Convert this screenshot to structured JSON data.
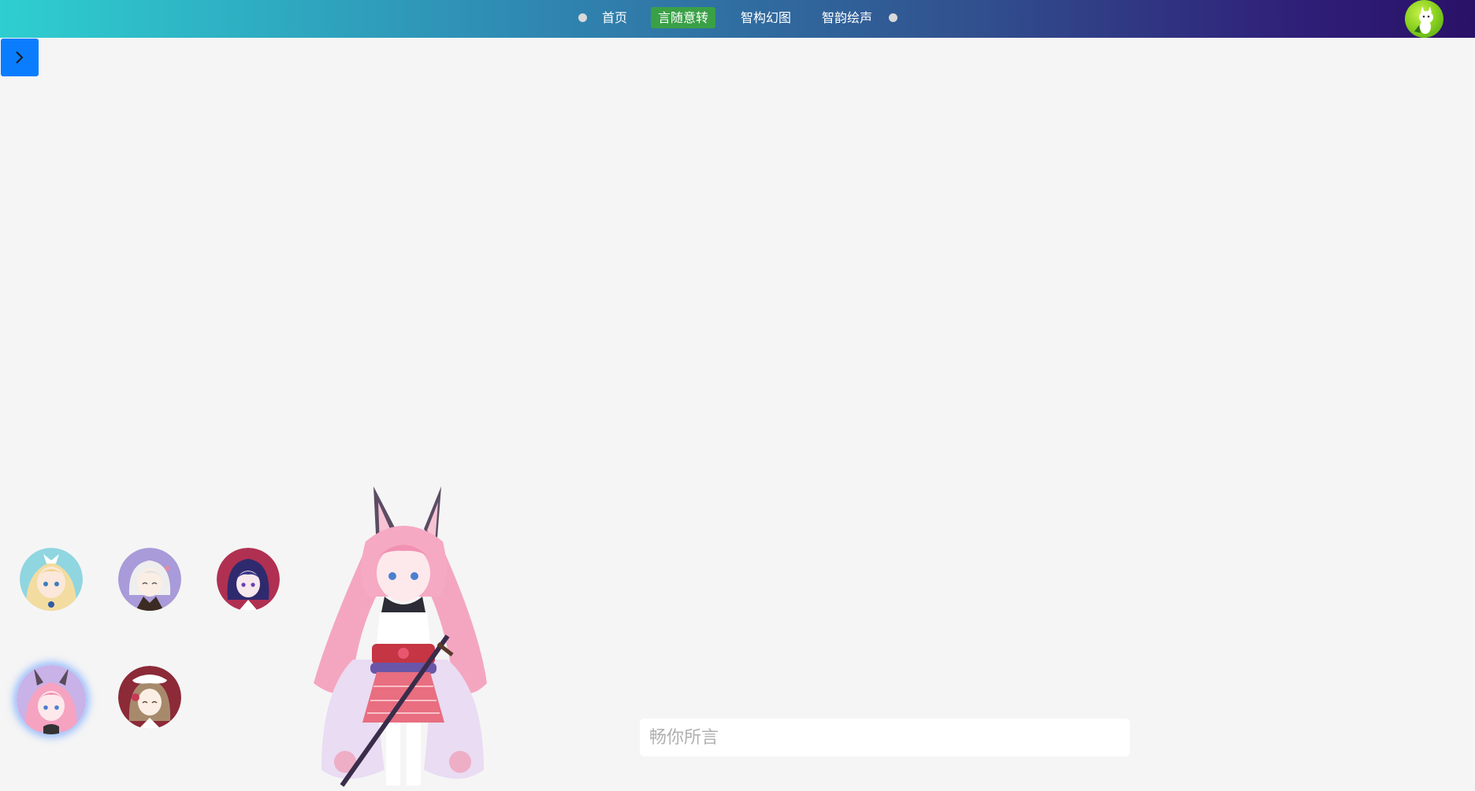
{
  "nav": {
    "items": [
      {
        "label": "首页",
        "active": false
      },
      {
        "label": "言随意转",
        "active": true
      },
      {
        "label": "智构幻图",
        "active": false
      },
      {
        "label": "智韵绘声",
        "active": false
      }
    ],
    "active_color": "#3aa046"
  },
  "header": {
    "gradient_colors": [
      "#2ecfd0",
      "#31528f",
      "#2a1168"
    ],
    "user_avatar_icon": "cartoon-cat-avatar"
  },
  "sidebar_toggle": {
    "icon": "chevron-right-icon",
    "color": "#0a7dff"
  },
  "characters": [
    {
      "icon": "blonde-character-avatar",
      "selected": false
    },
    {
      "icon": "silver-hair-character-avatar",
      "selected": false
    },
    {
      "icon": "dark-hair-character-avatar",
      "selected": false
    },
    {
      "icon": "pink-fox-character-avatar",
      "selected": true
    },
    {
      "icon": "maid-character-avatar",
      "selected": false
    }
  ],
  "chat": {
    "placeholder": "畅你所言"
  }
}
